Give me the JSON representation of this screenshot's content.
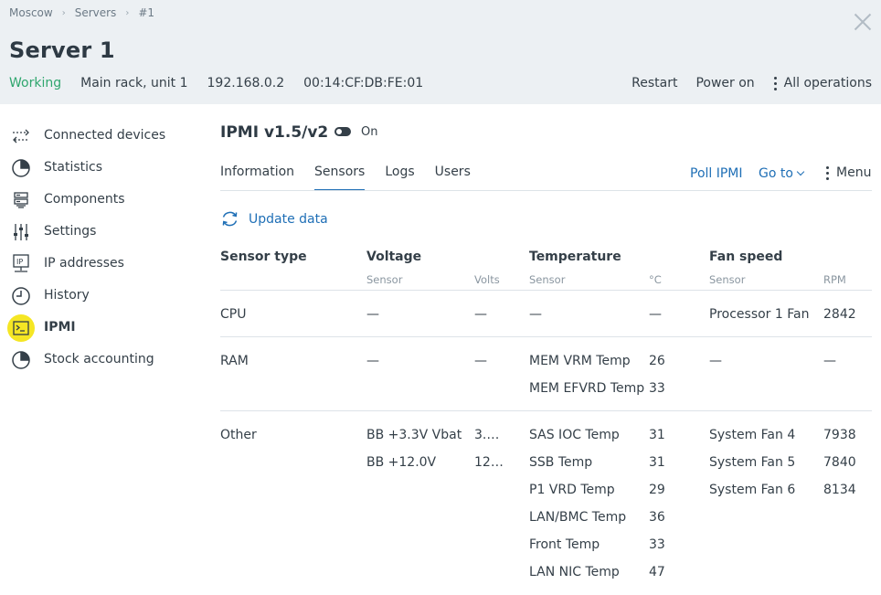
{
  "breadcrumb": [
    "Moscow",
    "Servers",
    "#1"
  ],
  "header": {
    "title": "Server 1",
    "status": "Working",
    "location": "Main rack, unit 1",
    "ip": "192.168.0.2",
    "mac": "00:14:CF:DB:FE:01"
  },
  "actions": {
    "restart": "Restart",
    "power_on": "Power on",
    "all_operations": "All operations"
  },
  "sidebar": {
    "items": [
      {
        "label": "Connected devices",
        "icon": "connected-devices-icon"
      },
      {
        "label": "Statistics",
        "icon": "pie-chart-icon"
      },
      {
        "label": "Components",
        "icon": "components-icon"
      },
      {
        "label": "Settings",
        "icon": "sliders-icon"
      },
      {
        "label": "IP addresses",
        "icon": "ip-icon"
      },
      {
        "label": "History",
        "icon": "clock-icon"
      },
      {
        "label": "IPMI",
        "icon": "terminal-icon",
        "active": true
      },
      {
        "label": "Stock accounting",
        "icon": "pie-chart-icon"
      }
    ]
  },
  "ipmi": {
    "title": "IPMI v1.5/v2",
    "toggle_label": "On"
  },
  "tabs": [
    "Information",
    "Sensors",
    "Logs",
    "Users"
  ],
  "toolbar": {
    "poll": "Poll IPMI",
    "goto": "Go to",
    "menu": "Menu"
  },
  "update_label": "Update data",
  "table": {
    "headers": {
      "sensor_type": "Sensor type",
      "voltage": "Voltage",
      "temperature": "Temperature",
      "fan": "Fan speed"
    },
    "subheaders": {
      "v_sensor": "Sensor",
      "v_unit": "Volts",
      "t_sensor": "Sensor",
      "t_unit": "°C",
      "f_sensor": "Sensor",
      "f_unit": "RPM"
    },
    "cpu": {
      "type": "CPU",
      "voltage": [
        {
          "sensor": "—",
          "value": "—"
        }
      ],
      "temperature": [
        {
          "sensor": "—",
          "value": "—"
        }
      ],
      "fan": [
        {
          "sensor": "Processor 1 Fan",
          "value": "2842"
        }
      ]
    },
    "ram": {
      "type": "RAM",
      "voltage": [
        {
          "sensor": "—",
          "value": "—"
        }
      ],
      "temperature": [
        {
          "sensor": "MEM VRM Temp",
          "value": "26"
        },
        {
          "sensor": "MEM EFVRD Temp",
          "value": "33"
        }
      ],
      "fan": [
        {
          "sensor": "—",
          "value": "—"
        }
      ]
    },
    "other": {
      "type": "Other",
      "voltage": [
        {
          "sensor": "BB +3.3V Vbat",
          "value": "3.…"
        },
        {
          "sensor": "BB +12.0V",
          "value": "12…"
        }
      ],
      "temperature": [
        {
          "sensor": "SAS IOC Temp",
          "value": "31"
        },
        {
          "sensor": "SSB Temp",
          "value": "31"
        },
        {
          "sensor": "P1 VRD Temp",
          "value": "29"
        },
        {
          "sensor": "LAN/BMC Temp",
          "value": "36"
        },
        {
          "sensor": "Front Temp",
          "value": "33"
        },
        {
          "sensor": "LAN NIC Temp",
          "value": "47"
        }
      ],
      "fan": [
        {
          "sensor": "System Fan 4",
          "value": "7938"
        },
        {
          "sensor": "System Fan 5",
          "value": "7840"
        },
        {
          "sensor": "System Fan 6",
          "value": "8134"
        }
      ]
    }
  },
  "colors": {
    "accent": "#1f6fb6",
    "status_working": "#2fa66e",
    "active_highlight": "#f5e624",
    "header_bg": "#ecf0f3"
  }
}
